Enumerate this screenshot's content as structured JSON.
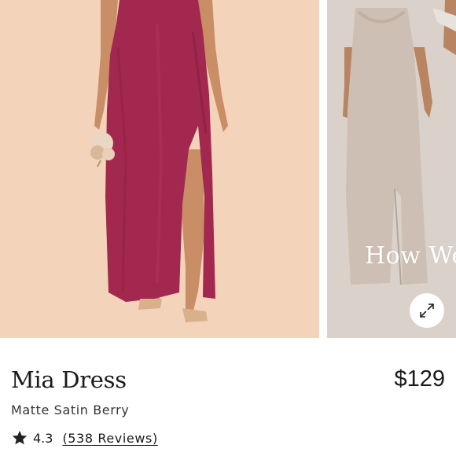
{
  "product": {
    "name": "Mia Dress",
    "price": "$129",
    "variant": "Matte Satin Berry",
    "rating": "4.3",
    "reviews_label": "(538 Reviews)"
  },
  "gallery": {
    "overlay_text": "How We",
    "images": [
      {
        "name": "dress-berry-model",
        "background": "#f3d4bb",
        "dress_color": "#a3284f"
      },
      {
        "name": "dress-champagne-model",
        "background": "#dad2ca",
        "dress_color": "#cdbfb3"
      }
    ],
    "expand_icon": "expand-icon"
  },
  "icons": {
    "rating": "star-icon"
  }
}
